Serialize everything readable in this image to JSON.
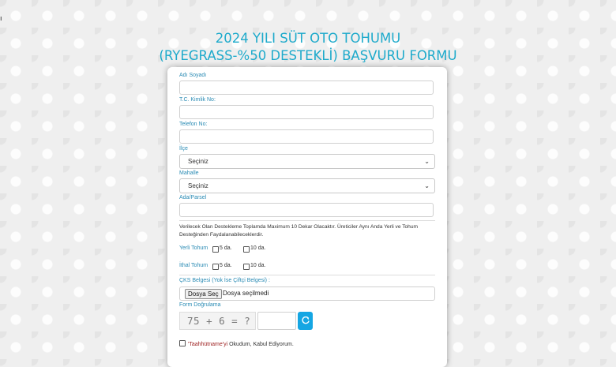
{
  "corner_mark": "ı",
  "title": {
    "line1": "2024 YILI SÜT OTO TOHUMU",
    "line2": "(RYEGRASS-%50 DESTEKLİ) BAŞVURU FORMU"
  },
  "form": {
    "name_label": "Adı Soyadı",
    "tc_label": "T.C. Kimlik No:",
    "phone_label": "Telefon No:",
    "district_label": "İlçe",
    "district_value": "Seçiniz",
    "neighborhood_label": "Mahalle",
    "neighborhood_value": "Seçiniz",
    "parcel_label": "Ada/Parsel",
    "info_text": "Verilecek Olan Destekleme Toplamda Maximum 10 Dekar Olacaktır. Üreticiler Aynı Anda Yerli ve Tohum Desteğinden Faydalanabileceklerdir.",
    "local_seed": {
      "label": "Yerli Tohum",
      "opt1": "5 da.",
      "opt2": "10 da."
    },
    "import_seed": {
      "label": "İthal Tohum",
      "opt1": "5 da.",
      "opt2": "10 da."
    },
    "cks_label": "ÇKS Belgesi (Yok İse Çiftçi Belgesi) :",
    "file_button": "Dosya Seç",
    "file_status": "Dosya seçilmedi",
    "captcha_label": "Form Doğrulama",
    "captcha_text": "75 + 6 = ?",
    "refresh_icon": "refresh-icon",
    "consent_link": "'Taahhütname'yi",
    "consent_text": " Okudum, Kabul Ediyorum."
  },
  "colors": {
    "title": "#1eaacb",
    "label": "#2a8bb4",
    "refresh_button": "#15a6e3",
    "consent_link": "#9b1c1c"
  }
}
